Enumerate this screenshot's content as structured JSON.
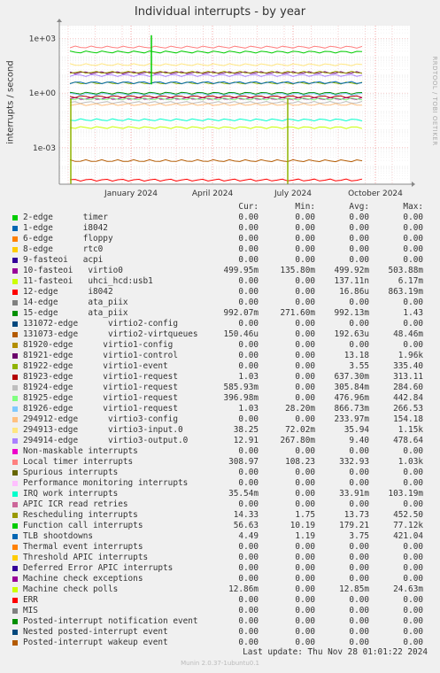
{
  "title": "Individual interrupts - by year",
  "side_text": "RRDTOOL / TOBI OETIKER",
  "footer": {
    "last_update": "Last update: Thu Nov 28 01:01:22 2024",
    "munin": "Munin 2.0.37-1ubuntu0.1"
  },
  "legend_headers": [
    "Cur:",
    "Min:",
    "Avg:",
    "Max:"
  ],
  "chart_data": {
    "type": "line",
    "title": "Individual interrupts - by year",
    "ylabel": "interrupts / second",
    "yscale": "log",
    "ylim": [
      1e-05,
      5000
    ],
    "yticks": [
      "1e-03",
      "1e+00",
      "1e+03"
    ],
    "xticks": [
      "January 2024",
      "April 2024",
      "July 2024",
      "October 2024"
    ],
    "grid": true,
    "series": [
      {
        "name": "2-edge      timer",
        "color": "#00cc00",
        "values": [
          "0.00",
          "0.00",
          "0.00",
          "0.00"
        ]
      },
      {
        "name": "1-edge      i8042",
        "color": "#0066b3",
        "values": [
          "0.00",
          "0.00",
          "0.00",
          "0.00"
        ]
      },
      {
        "name": "6-edge      floppy",
        "color": "#ff8000",
        "values": [
          "0.00",
          "0.00",
          "0.00",
          "0.00"
        ]
      },
      {
        "name": "8-edge      rtc0",
        "color": "#ffcc00",
        "values": [
          "0.00",
          "0.00",
          "0.00",
          "0.00"
        ]
      },
      {
        "name": "9-fasteoi   acpi",
        "color": "#330099",
        "values": [
          "0.00",
          "0.00",
          "0.00",
          "0.00"
        ]
      },
      {
        "name": "10-fasteoi   virtio0",
        "color": "#990099",
        "values": [
          "499.95m",
          "135.80m",
          "499.92m",
          "503.88m"
        ]
      },
      {
        "name": "11-fasteoi   uhci_hcd:usb1",
        "color": "#ccff00",
        "values": [
          "0.00",
          "0.00",
          "137.11n",
          "6.17m"
        ]
      },
      {
        "name": "12-edge      i8042",
        "color": "#ff0000",
        "values": [
          "0.00",
          "0.00",
          "16.86u",
          "863.19m"
        ]
      },
      {
        "name": "14-edge      ata_piix",
        "color": "#808080",
        "values": [
          "0.00",
          "0.00",
          "0.00",
          "0.00"
        ]
      },
      {
        "name": "15-edge      ata_piix",
        "color": "#008f00",
        "values": [
          "992.07m",
          "271.60m",
          "992.13m",
          "1.43"
        ]
      },
      {
        "name": "131072-edge      virtio2-config",
        "color": "#00487d",
        "values": [
          "0.00",
          "0.00",
          "0.00",
          "0.00"
        ]
      },
      {
        "name": "131073-edge      virtio2-virtqueues",
        "color": "#b35a00",
        "values": [
          "150.46u",
          "0.00",
          "192.63u",
          "48.46m"
        ]
      },
      {
        "name": "81920-edge      virtio1-config",
        "color": "#b38f00",
        "values": [
          "0.00",
          "0.00",
          "0.00",
          "0.00"
        ]
      },
      {
        "name": "81921-edge      virtio1-control",
        "color": "#6b006b",
        "values": [
          "0.00",
          "0.00",
          "13.18",
          "1.96k"
        ]
      },
      {
        "name": "81922-edge      virtio1-event",
        "color": "#8fb300",
        "values": [
          "0.00",
          "0.00",
          "3.55",
          "335.40"
        ]
      },
      {
        "name": "81923-edge      virtio1-request",
        "color": "#b30000",
        "values": [
          "1.03",
          "0.00",
          "637.30m",
          "313.11"
        ]
      },
      {
        "name": "81924-edge      virtio1-request",
        "color": "#bebebe",
        "values": [
          "585.93m",
          "0.00",
          "305.84m",
          "284.60"
        ]
      },
      {
        "name": "81925-edge      virtio1-request",
        "color": "#80ff80",
        "values": [
          "396.98m",
          "0.00",
          "476.96m",
          "442.84"
        ]
      },
      {
        "name": "81926-edge      virtio1-request",
        "color": "#80c9ff",
        "values": [
          "1.03",
          "28.20m",
          "866.73m",
          "266.53"
        ]
      },
      {
        "name": "294912-edge      virtio3-config",
        "color": "#ffc080",
        "values": [
          "0.00",
          "0.00",
          "233.97m",
          "154.18"
        ]
      },
      {
        "name": "294913-edge      virtio3-input.0",
        "color": "#ffe680",
        "values": [
          "38.25",
          "72.02m",
          "35.94",
          "1.15k"
        ]
      },
      {
        "name": "294914-edge      virtio3-output.0",
        "color": "#aa80ff",
        "values": [
          "12.91",
          "267.80m",
          "9.40",
          "478.64"
        ]
      },
      {
        "name": "Non-maskable interrupts",
        "color": "#ee00cc",
        "values": [
          "0.00",
          "0.00",
          "0.00",
          "0.00"
        ]
      },
      {
        "name": "Local timer interrupts",
        "color": "#ff8080",
        "values": [
          "308.97",
          "108.23",
          "332.93",
          "1.03k"
        ]
      },
      {
        "name": "Spurious interrupts",
        "color": "#666600",
        "values": [
          "0.00",
          "0.00",
          "0.00",
          "0.00"
        ]
      },
      {
        "name": "Performance monitoring interrupts",
        "color": "#ffbfff",
        "values": [
          "0.00",
          "0.00",
          "0.00",
          "0.00"
        ]
      },
      {
        "name": "IRQ work interrupts",
        "color": "#00ffcc",
        "values": [
          "35.54m",
          "0.00",
          "33.91m",
          "103.19m"
        ]
      },
      {
        "name": "APIC ICR read retries",
        "color": "#cc6699",
        "values": [
          "0.00",
          "0.00",
          "0.00",
          "0.00"
        ]
      },
      {
        "name": "Rescheduling interrupts",
        "color": "#999900",
        "values": [
          "14.33",
          "1.75",
          "13.73",
          "452.50"
        ]
      },
      {
        "name": "Function call interrupts",
        "color": "#00cc00",
        "values": [
          "56.63",
          "10.19",
          "179.21",
          "77.12k"
        ]
      },
      {
        "name": "TLB shootdowns",
        "color": "#0066b3",
        "values": [
          "4.49",
          "1.19",
          "3.75",
          "421.04"
        ]
      },
      {
        "name": "Thermal event interrupts",
        "color": "#ff8000",
        "values": [
          "0.00",
          "0.00",
          "0.00",
          "0.00"
        ]
      },
      {
        "name": "Threshold APIC interrupts",
        "color": "#ffcc00",
        "values": [
          "0.00",
          "0.00",
          "0.00",
          "0.00"
        ]
      },
      {
        "name": "Deferred Error APIC interrupts",
        "color": "#330099",
        "values": [
          "0.00",
          "0.00",
          "0.00",
          "0.00"
        ]
      },
      {
        "name": "Machine check exceptions",
        "color": "#990099",
        "values": [
          "0.00",
          "0.00",
          "0.00",
          "0.00"
        ]
      },
      {
        "name": "Machine check polls",
        "color": "#ccff00",
        "values": [
          "12.86m",
          "0.00",
          "12.85m",
          "24.63m"
        ]
      },
      {
        "name": "ERR",
        "color": "#ff0000",
        "values": [
          "0.00",
          "0.00",
          "0.00",
          "0.00"
        ]
      },
      {
        "name": "MIS",
        "color": "#808080",
        "values": [
          "0.00",
          "0.00",
          "0.00",
          "0.00"
        ]
      },
      {
        "name": "Posted-interrupt notification event",
        "color": "#008f00",
        "values": [
          "0.00",
          "0.00",
          "0.00",
          "0.00"
        ]
      },
      {
        "name": "Nested posted-interrupt event",
        "color": "#00487d",
        "values": [
          "0.00",
          "0.00",
          "0.00",
          "0.00"
        ]
      },
      {
        "name": "Posted-interrupt wakeup event",
        "color": "#b35a00",
        "values": [
          "0.00",
          "0.00",
          "0.00",
          "0.00"
        ]
      }
    ]
  }
}
